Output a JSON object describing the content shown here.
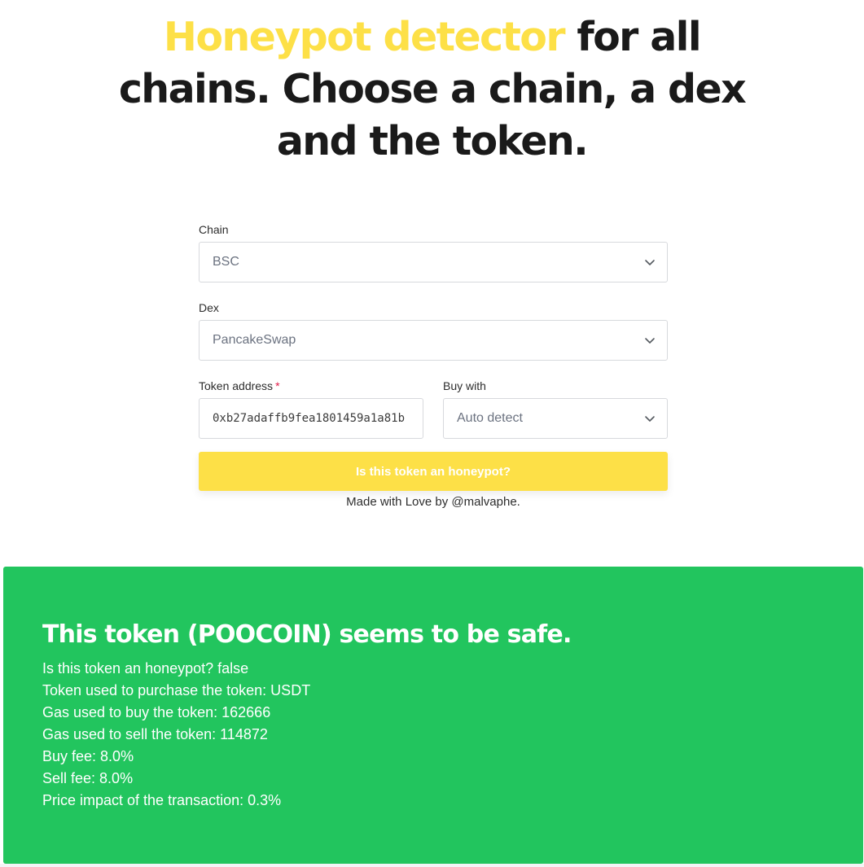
{
  "headline": {
    "accent": "Honeypot detector",
    "rest": " for all chains. Choose a chain, a dex and the token."
  },
  "form": {
    "chain": {
      "label": "Chain",
      "value": "BSC"
    },
    "dex": {
      "label": "Dex",
      "value": "PancakeSwap"
    },
    "token_address": {
      "label": "Token address",
      "required_mark": "*",
      "value": "0xb27adaffb9fea1801459a1a81b"
    },
    "buy_with": {
      "label": "Buy with",
      "value": "Auto detect"
    },
    "submit_label": "Is this token an honeypot?",
    "credit": "Made with Love by @malvaphe."
  },
  "result": {
    "title": "This token (POOCOIN) seems to be safe.",
    "lines": [
      "Is this token an honeypot? false",
      "Token used to purchase the token: USDT",
      "Gas used to buy the token: 162666",
      "Gas used to sell the token: 114872",
      "Buy fee: 8.0%",
      "Sell fee: 8.0%",
      "Price impact of the transaction: 0.3%"
    ]
  },
  "colors": {
    "accent": "#fde047",
    "success": "#22c55e",
    "required": "#e11d48"
  },
  "icons": {
    "dropdown": "chevron-down-icon"
  }
}
